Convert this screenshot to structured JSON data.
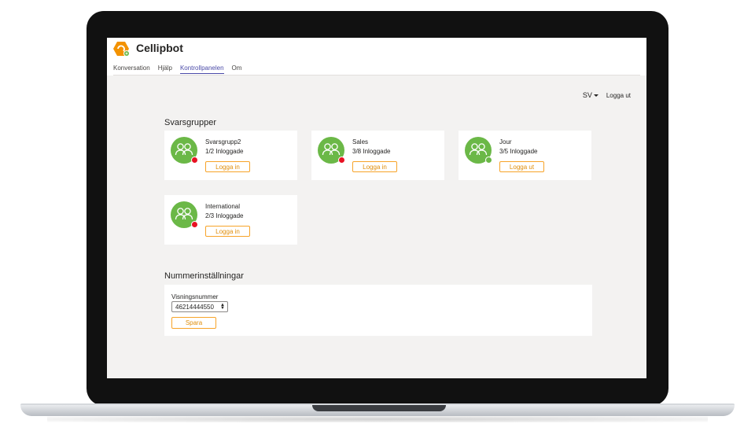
{
  "app": {
    "title": "Cellipbot",
    "brand_color": "#f39200",
    "accent_color": "#4b4ba8"
  },
  "nav": {
    "tabs": [
      {
        "label": "Konversation",
        "active": false
      },
      {
        "label": "Hjälp",
        "active": false
      },
      {
        "label": "Kontrollpanelen",
        "active": true
      },
      {
        "label": "Om",
        "active": false
      }
    ]
  },
  "toolbar": {
    "language": "SV",
    "logout_label": "Logga ut"
  },
  "groups_section": {
    "title": "Svarsgrupper",
    "groups": [
      {
        "name": "Svarsgrupp2",
        "count": "1/2 Inloggade",
        "button": "Logga in",
        "status_color": "#e81123"
      },
      {
        "name": "Sales",
        "count": "3/8 Inloggade",
        "button": "Logga in",
        "status_color": "#e81123"
      },
      {
        "name": "Jour",
        "count": "3/5 Inloggade",
        "button": "Logga ut",
        "status_color": "#6bb847"
      },
      {
        "name": "International",
        "count": "2/3 Inloggade",
        "button": "Logga in",
        "status_color": "#e81123"
      }
    ]
  },
  "number_section": {
    "title": "Nummerinställningar",
    "field_label": "Visningsnummer",
    "selected_number": "46214444550",
    "save_label": "Spara"
  },
  "icons": {
    "group": "group-icon",
    "logo": "cellipbot-logo-icon"
  }
}
